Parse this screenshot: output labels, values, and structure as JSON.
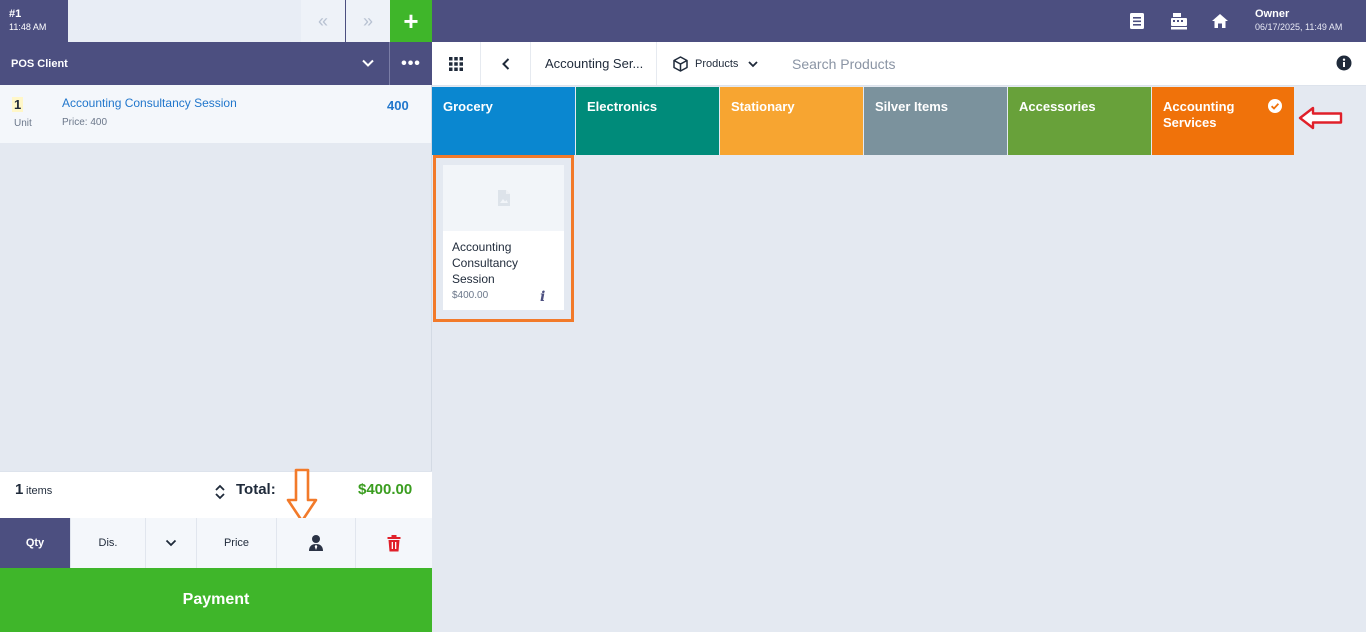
{
  "ticket": {
    "number": "#1",
    "time": "11:48 AM"
  },
  "topbar": {
    "prev_icon": "double-chevron-left-icon",
    "next_icon": "double-chevron-right-icon",
    "add_icon": "plus-icon",
    "add_label": "+",
    "icons": [
      "document-list-icon",
      "cash-register-icon",
      "home-icon"
    ],
    "user_name": "Owner",
    "datetime": "06/17/2025, 11:49 AM"
  },
  "client": {
    "label": "POS Client",
    "more_label": "•••"
  },
  "cart": {
    "lines": [
      {
        "qty": "1",
        "unit": "Unit",
        "name": "Accounting Consultancy Session",
        "price": "Price: 400",
        "total": "400"
      }
    ],
    "items_count": "1",
    "items_word": "items",
    "total_label": "Total:",
    "total_value": "$400.00"
  },
  "toolbar": {
    "qty": "Qty",
    "discount": "Dis.",
    "price": "Price"
  },
  "payment_label": "Payment",
  "header": {
    "breadcrumb": "Accounting Ser...",
    "products_label": "Products",
    "search_placeholder": "Search Products"
  },
  "categories": [
    {
      "name": "Grocery",
      "color": "#0a87d0"
    },
    {
      "name": "Electronics",
      "color": "#008b7a"
    },
    {
      "name": "Stationary",
      "color": "#f7a531"
    },
    {
      "name": "Silver Items",
      "color": "#7b929d"
    },
    {
      "name": "Accessories",
      "color": "#68a13a"
    },
    {
      "name": "Accounting Services",
      "color": "#f0720a",
      "selected": true
    }
  ],
  "products": [
    {
      "name": "Accounting Consultancy Session",
      "price": "$400.00",
      "info": "i"
    }
  ],
  "colors": {
    "header": "#4c4f80",
    "accent_green": "#3fb62a",
    "annotation_orange": "#f27a2a",
    "annotation_red": "#e0202a"
  }
}
